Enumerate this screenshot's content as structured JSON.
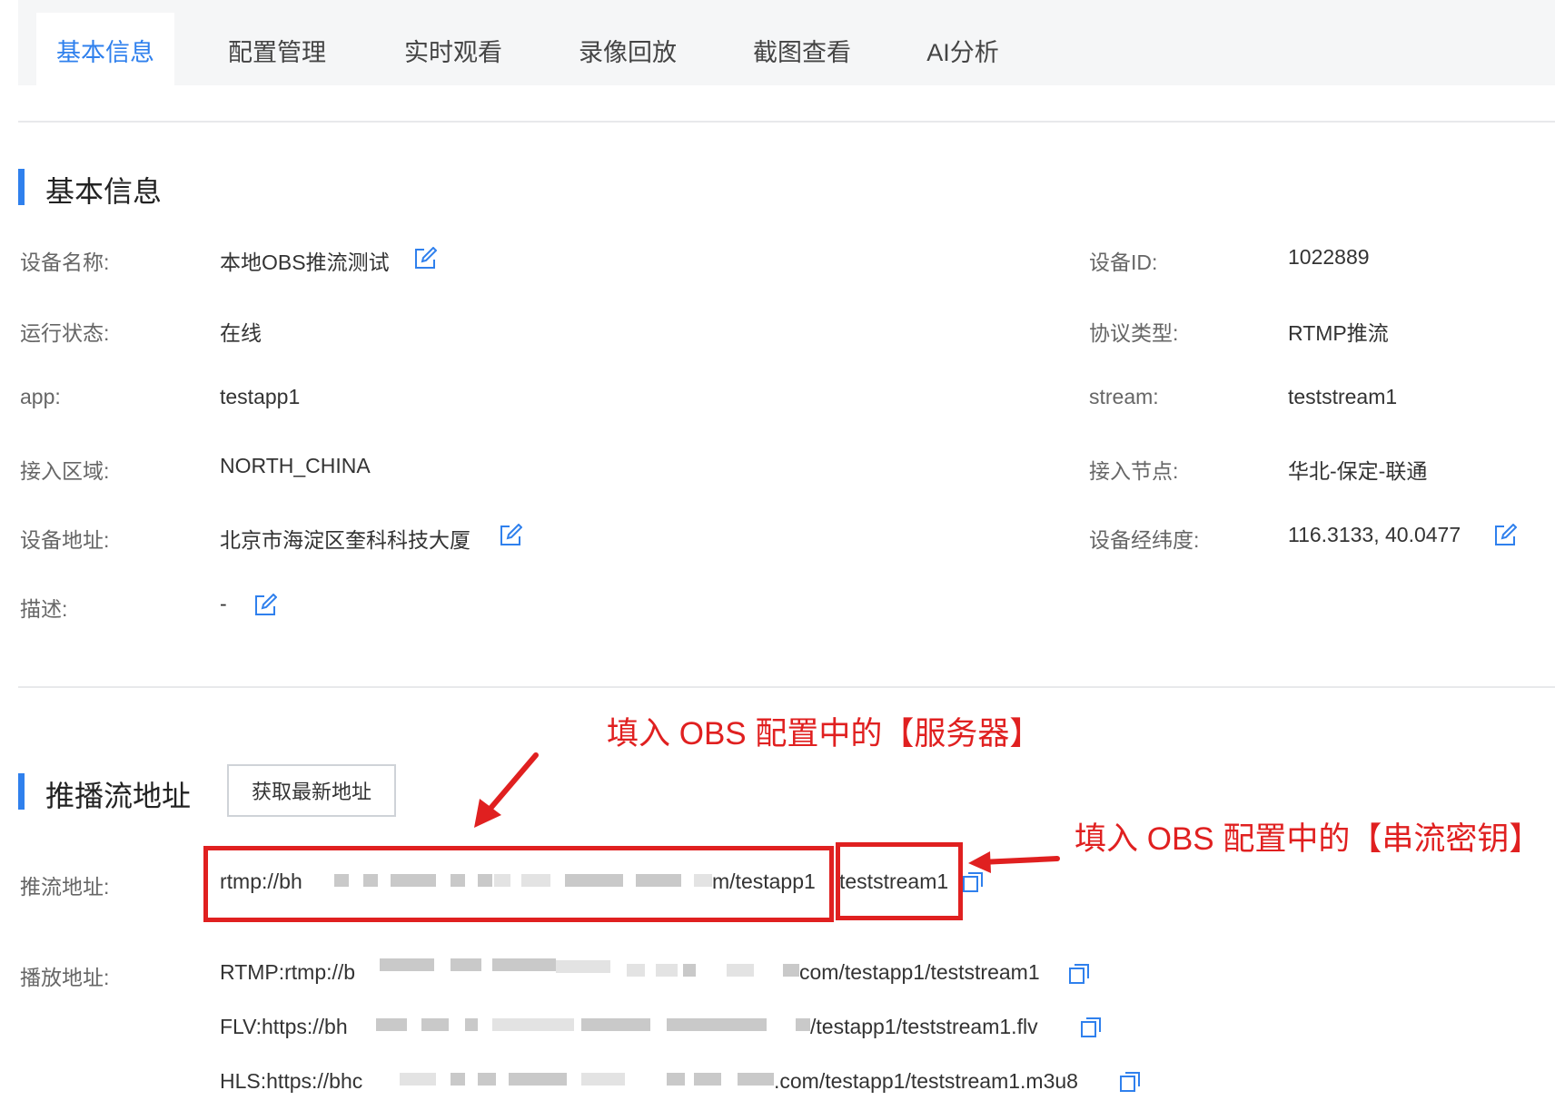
{
  "tabs": [
    {
      "label": "基本信息",
      "active": true
    },
    {
      "label": "配置管理"
    },
    {
      "label": "实时观看"
    },
    {
      "label": "录像回放"
    },
    {
      "label": "截图查看"
    },
    {
      "label": "AI分析"
    }
  ],
  "basic": {
    "title": "基本信息",
    "device_name": {
      "label": "设备名称:",
      "value": "本地OBS推流测试"
    },
    "device_id": {
      "label": "设备ID:",
      "value": "1022889"
    },
    "status": {
      "label": "运行状态:",
      "value": "在线"
    },
    "protocol": {
      "label": "协议类型:",
      "value": "RTMP推流"
    },
    "app": {
      "label": "app:",
      "value": "testapp1"
    },
    "stream": {
      "label": "stream:",
      "value": "teststream1"
    },
    "region": {
      "label": "接入区域:",
      "value": "NORTH_CHINA"
    },
    "node": {
      "label": "接入节点:",
      "value": "华北-保定-联通"
    },
    "address": {
      "label": "设备地址:",
      "value": "北京市海淀区奎科科技大厦"
    },
    "coords": {
      "label": "设备经纬度:",
      "value": "116.3133, 40.0477"
    },
    "desc": {
      "label": "描述:",
      "value": "-"
    }
  },
  "streams": {
    "title": "推播流地址",
    "refresh_button": "获取最新地址",
    "push_label": "推流地址:",
    "push_prefix": "rtmp://bh",
    "push_suffix": "m/testapp1",
    "push_key": "teststream1",
    "play_label": "播放地址:",
    "play": [
      {
        "prefix": "RTMP:rtmp://b",
        "suffix": "com/testapp1/teststream1"
      },
      {
        "prefix": "FLV:https://bh",
        "suffix": "/testapp1/teststream1.flv"
      },
      {
        "prefix": "HLS:https://bhc",
        "suffix": ".com/testapp1/teststream1.m3u8"
      }
    ]
  },
  "annotations": {
    "server": "填入 OBS 配置中的【服务器】",
    "key": "填入 OBS 配置中的【串流密钥】"
  },
  "icons": {
    "edit": "edit-icon",
    "copy": "copy-icon",
    "arrow": "arrow-icon"
  },
  "colors": {
    "accent": "#2f80ed",
    "annotation": "#e02020",
    "tab_bg": "#f5f6f7"
  }
}
